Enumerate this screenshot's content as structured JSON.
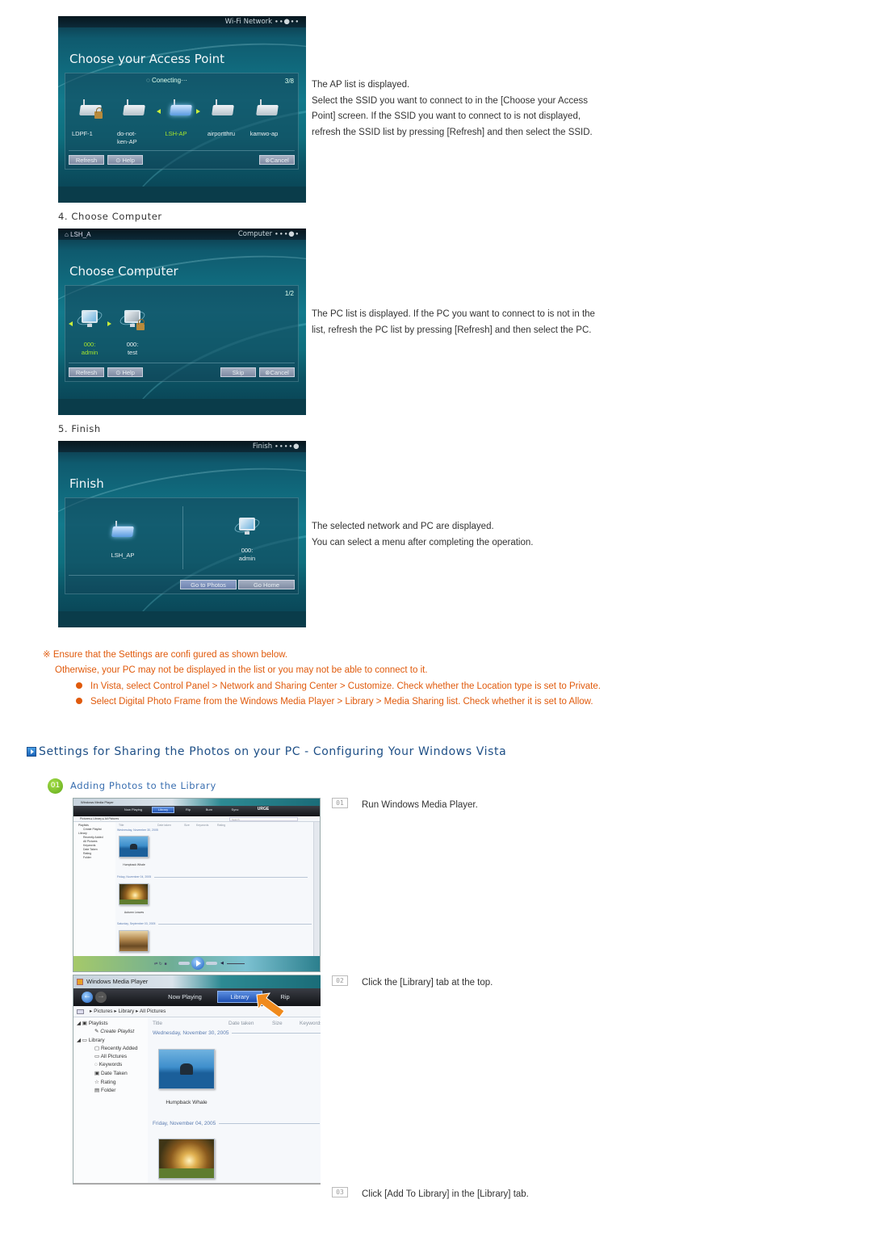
{
  "access_point": {
    "screen": {
      "crumb": "Wi-Fi Network",
      "title": "Choose your Access Point",
      "status": "Conecting···",
      "page": "3/8",
      "items": [
        {
          "label": "LDPF-1",
          "locked": true,
          "selected": false
        },
        {
          "label": "do-not-ken-AP",
          "locked": false,
          "selected": false
        },
        {
          "label": "LSH-AP",
          "locked": false,
          "selected": true
        },
        {
          "label": "airportthru",
          "locked": false,
          "selected": false
        },
        {
          "label": "kamwo-ap",
          "locked": false,
          "selected": false
        }
      ],
      "buttons": {
        "refresh": "Refresh",
        "help": "Help",
        "cancel": "Cancel"
      }
    },
    "description": [
      "The AP list is displayed.",
      "Select the SSID you want to connect to in the [Choose your Access",
      "Point] screen. If the SSID you want to connect to is not displayed,",
      "refresh the SSID list by pressing [Refresh] and then select the SSID."
    ]
  },
  "choose_computer": {
    "step_label": "4. Choose Computer",
    "screen": {
      "network_name": "LSH_A",
      "crumb": "Computer",
      "title": "Choose Computer",
      "page": "1/2",
      "items": [
        {
          "label_line1": "000:",
          "label_line2": "admin",
          "locked": false,
          "selected": true
        },
        {
          "label_line1": "000:",
          "label_line2": "test",
          "locked": true,
          "selected": false
        }
      ],
      "buttons": {
        "refresh": "Refresh",
        "help": "Help",
        "skip": "Skip",
        "cancel": "Cancel"
      }
    },
    "description": [
      "The PC list is displayed. If the PC you want to connect to is not in the",
      "list, refresh the PC list by pressing [Refresh] and then select the PC."
    ]
  },
  "finish": {
    "step_label": "5. Finish",
    "screen": {
      "crumb": "Finish",
      "title": "Finish",
      "network_label": "LSH_AP",
      "pc_label_line1": "000:",
      "pc_label_line2": "admin",
      "buttons": {
        "go_to_photos": "Go to Photos",
        "go_home": "Go Home"
      }
    },
    "description": [
      "The selected network and PC are displayed.",
      "You can select a menu after completing the operation."
    ]
  },
  "notes": {
    "marker": "※",
    "line1": "Ensure that the Settings are confi gured as shown below.",
    "line2": "Otherwise, your PC may not be displayed in the list or you may not be able to connect to it.",
    "bullets": [
      "In Vista, select Control Panel > Network and Sharing Center > Customize. Check whether the Location type is set to Private.",
      "Select Digital Photo Frame from the Windows Media Player > Library > Media Sharing list. Check whether it is set to Allow."
    ],
    "color": "#e05a0c"
  },
  "section": {
    "title": "Settings for Sharing the Photos on your PC - Configuring Your Windows Vista",
    "subsection_number": "01",
    "subsection_title": "Adding Photos to the Library"
  },
  "steps": [
    {
      "number": "01",
      "text": "Run Windows Media Player."
    },
    {
      "number": "02",
      "text": "Click the [Library] tab at the top."
    },
    {
      "number": "03",
      "text": "Click [Add To Library] in the [Library] tab."
    }
  ],
  "wmp": {
    "window_title": "Windows Media Player",
    "tabs": [
      "Now Playing",
      "Library",
      "Rip",
      "Burn",
      "Sync"
    ],
    "brand": "URGE",
    "breadcrumb": [
      "Pictures",
      "Library",
      "All Pictures"
    ],
    "search_placeholder": "Search",
    "sidebar": {
      "playlists": "Playlists",
      "create_playlist": "Create Playlist",
      "library": "Library",
      "library_items": [
        "Recently Added",
        "All Pictures",
        "Keywords",
        "Date Taken",
        "Rating",
        "Folder"
      ]
    },
    "columns": [
      "Title",
      "Date taken",
      "Size",
      "Keywords",
      "Rating"
    ],
    "groups": [
      {
        "date": "Wednesday, November 30, 2005",
        "caption": "Humpback Whale"
      },
      {
        "date": "Friday, November 04, 2005",
        "caption": "Autumn Leaves"
      },
      {
        "date": "Saturday, September 03, 2005",
        "caption": ""
      }
    ]
  }
}
